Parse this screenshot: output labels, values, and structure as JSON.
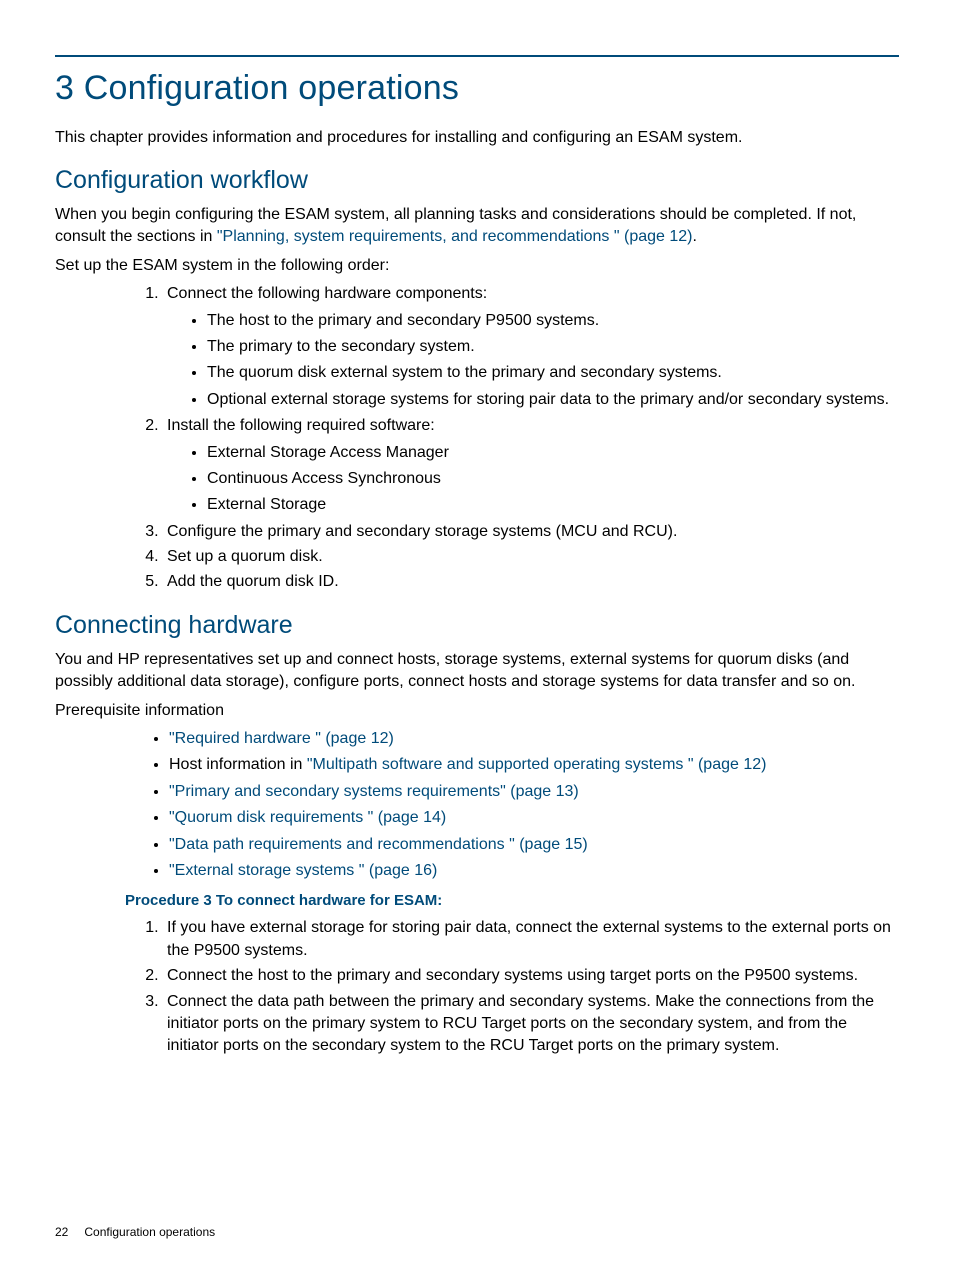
{
  "title": "3 Configuration operations",
  "intro": "This chapter provides information and procedures for installing and configuring an ESAM system.",
  "section1": {
    "heading": "Configuration workflow",
    "p1a": "When you begin configuring the ESAM system, all planning tasks and considerations should be completed. If not, consult the sections in ",
    "p1link": "\"Planning, system requirements, and recommendations \" (page 12)",
    "p1b": ".",
    "p2": "Set up the ESAM system in the following order:",
    "step1": "Connect the following hardware components:",
    "step1_items": [
      "The host to the primary and secondary P9500 systems.",
      "The primary to the secondary system.",
      "The quorum disk external system to the primary and secondary systems.",
      "Optional external storage systems for storing pair data to the primary and/or secondary systems."
    ],
    "step2": "Install the following required software:",
    "step2_items": [
      "External Storage Access Manager",
      "Continuous Access Synchronous",
      "External Storage"
    ],
    "step3": "Configure the primary and secondary storage systems (MCU and RCU).",
    "step4": "Set up a quorum disk.",
    "step5": "Add the quorum disk ID."
  },
  "section2": {
    "heading": "Connecting hardware",
    "p1": "You and HP representatives set up and connect hosts, storage systems, external systems for quorum disks (and possibly additional data storage), configure ports, connect hosts and storage systems for data transfer and so on.",
    "p2": "Prerequisite information",
    "bullets": [
      {
        "pre": "",
        "link": "\"Required hardware \" (page 12)",
        "post": ""
      },
      {
        "pre": "Host information in ",
        "link": "\"Multipath software and supported operating systems \" (page 12)",
        "post": ""
      },
      {
        "pre": "",
        "link": "\"Primary and secondary systems requirements\" (page 13)",
        "post": ""
      },
      {
        "pre": "",
        "link": "\"Quorum disk requirements \" (page 14)",
        "post": ""
      },
      {
        "pre": "",
        "link": "\"Data path requirements and recommendations \" (page 15)",
        "post": ""
      },
      {
        "pre": "",
        "link": "\"External storage systems \" (page 16)",
        "post": ""
      }
    ],
    "proc_title": "Procedure 3 To connect hardware for ESAM:",
    "proc_steps": [
      "If you have external storage for storing pair data, connect the external systems to the external ports on the P9500 systems.",
      "Connect the host to the primary and secondary systems using target ports on the P9500 systems.",
      "Connect the data path between the primary and secondary systems. Make the connections from the initiator ports on the primary system to RCU Target ports on the secondary system, and from the initiator ports on the secondary system to the RCU Target ports on the primary system."
    ]
  },
  "footer": {
    "page": "22",
    "label": "Configuration operations"
  }
}
